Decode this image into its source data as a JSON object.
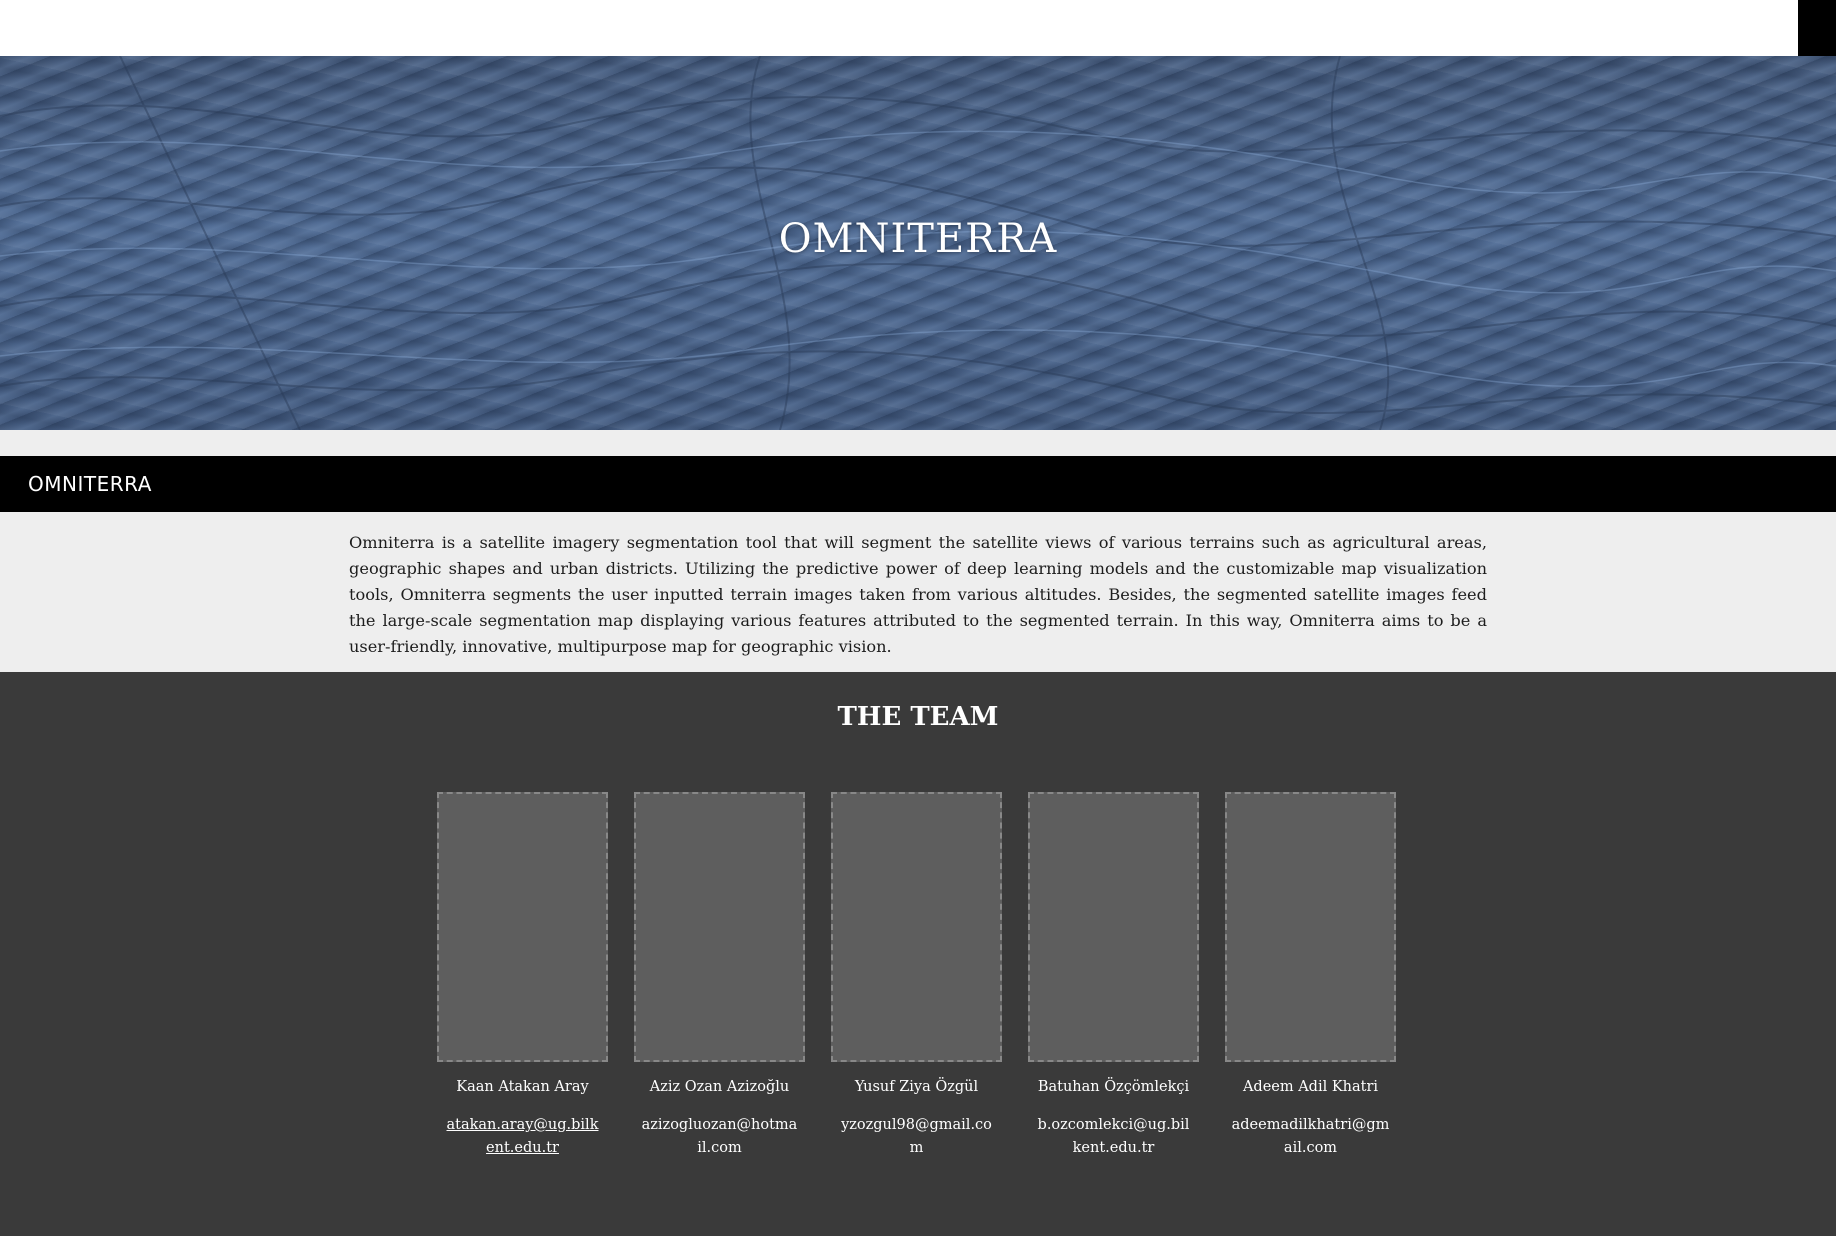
{
  "hero": {
    "title": "OMNITERRA"
  },
  "section": {
    "title": "OMNITERRA",
    "description": "Omniterra is a satellite imagery segmentation tool that will segment the satellite views of various terrains such as agricultural areas, geographic shapes and urban districts. Utilizing the predictive power of deep learning models and the customizable map visualization tools, Omniterra segments the user inputted terrain images taken from various altitudes. Besides, the segmented satellite images feed the large-scale segmentation map displaying various features attributed to the segmented terrain. In this way, Omniterra aims to be a user-friendly, innovative, multipurpose map for geographic vision."
  },
  "team": {
    "title": "THE TEAM",
    "members": [
      {
        "name": "Kaan Atakan Aray",
        "email": "atakan.aray@ug.bilkent.edu.tr"
      },
      {
        "name": "Aziz Ozan Azizoğlu",
        "email": "azizogluozan@hotmail.com"
      },
      {
        "name": "Yusuf Ziya Özgül",
        "email": "yzozgul98@gmail.com"
      },
      {
        "name": "Batuhan Özçömlekçi",
        "email": "b.ozcomlekci@ug.bilkent.edu.tr"
      },
      {
        "name": "Adeem Adil Khatri",
        "email": "adeemadilkhatri@gmail.com"
      }
    ]
  },
  "colors": {
    "hero_blue": "#506b93",
    "section_bar": "#000000",
    "light_band": "#eeeeee",
    "team_bg": "#3a3a3a",
    "photo_placeholder": "#5e5e5e"
  }
}
